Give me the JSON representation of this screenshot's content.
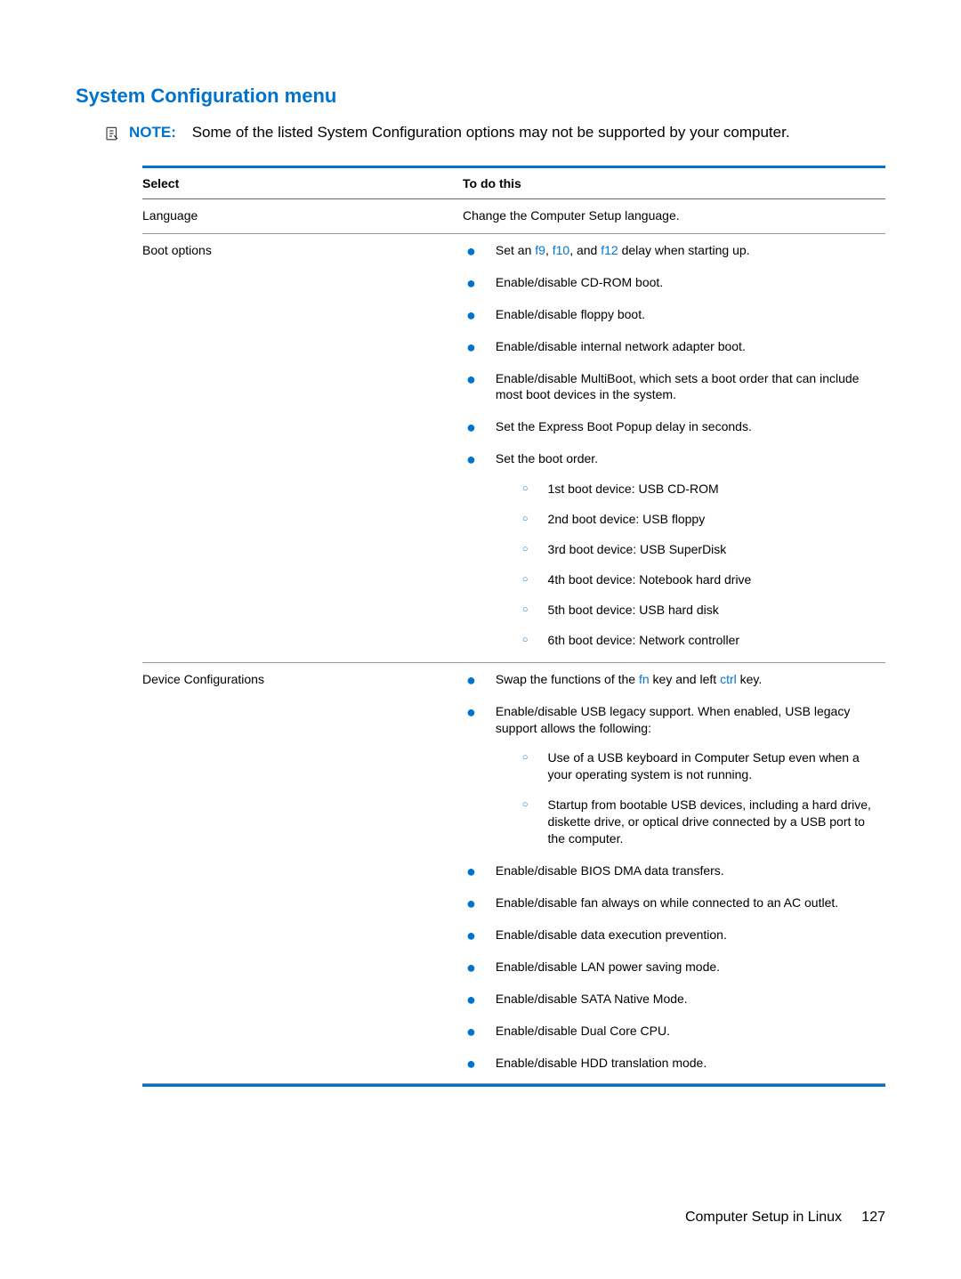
{
  "heading": "System Configuration menu",
  "note": {
    "label": "NOTE:",
    "text": "Some of the listed System Configuration options may not be supported by your computer."
  },
  "headers": {
    "select": "Select",
    "todo": "To do this"
  },
  "rows": {
    "language": {
      "select": "Language",
      "desc": "Change the Computer Setup language."
    },
    "boot": {
      "select": "Boot options",
      "b0_pre": "Set an ",
      "b0_k1": "f9",
      "b0_sep1": ", ",
      "b0_k2": "f10",
      "b0_sep2": ", and ",
      "b0_k3": "f12",
      "b0_post": " delay when starting up.",
      "b1": "Enable/disable CD-ROM boot.",
      "b2": "Enable/disable floppy boot.",
      "b3": "Enable/disable internal network adapter boot.",
      "b4": "Enable/disable MultiBoot, which sets a boot order that can include most boot devices in the system.",
      "b5": "Set the Express Boot Popup delay in seconds.",
      "b6": "Set the boot order.",
      "s0": "1st boot device: USB CD-ROM",
      "s1": "2nd boot device: USB floppy",
      "s2": "3rd boot device: USB SuperDisk",
      "s3": "4th boot device: Notebook hard drive",
      "s4": "5th boot device: USB hard disk",
      "s5": "6th boot device: Network controller"
    },
    "device": {
      "select": "Device Configurations",
      "b0_pre": "Swap the functions of the ",
      "b0_k1": "fn",
      "b0_mid": " key and left ",
      "b0_k2": "ctrl",
      "b0_post": " key.",
      "b1": "Enable/disable USB legacy support. When enabled, USB legacy support allows the following:",
      "s0": "Use of a USB keyboard in Computer Setup even when a your operating system is not running.",
      "s1": "Startup from bootable USB devices, including a hard drive, diskette drive, or optical drive connected by a USB port to the computer.",
      "b2": "Enable/disable BIOS DMA data transfers.",
      "b3": "Enable/disable fan always on while connected to an AC outlet.",
      "b4": "Enable/disable data execution prevention.",
      "b5": "Enable/disable LAN power saving mode.",
      "b6": "Enable/disable SATA Native Mode.",
      "b7": "Enable/disable Dual Core CPU.",
      "b8": "Enable/disable HDD translation mode."
    }
  },
  "footer": {
    "text": "Computer Setup in Linux",
    "page": "127"
  }
}
